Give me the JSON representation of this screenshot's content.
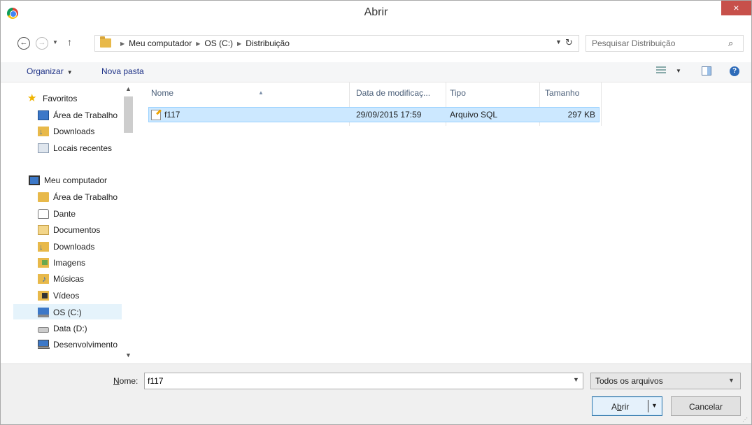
{
  "window": {
    "title": "Abrir",
    "close_label": "×"
  },
  "address": {
    "breadcrumbs": [
      "Meu computador",
      "OS (C:)",
      "Distribuição"
    ],
    "search_placeholder": "Pesquisar Distribuição"
  },
  "toolbar": {
    "organize_label": "Organizar",
    "new_folder_label": "Nova pasta"
  },
  "sidebar": {
    "items": [
      {
        "label": "Favoritos",
        "icon": "star-icon"
      },
      {
        "label": "Área de Trabalho",
        "icon": "desktop-icon"
      },
      {
        "label": "Downloads",
        "icon": "downloads-folder-icon"
      },
      {
        "label": "Locais recentes",
        "icon": "recent-places-icon"
      },
      {
        "label": "Meu computador",
        "icon": "computer-icon"
      },
      {
        "label": "Área de Trabalho",
        "icon": "desktop-folder-icon"
      },
      {
        "label": "Dante",
        "icon": "user-folder-icon"
      },
      {
        "label": "Documentos",
        "icon": "documents-folder-icon"
      },
      {
        "label": "Downloads",
        "icon": "downloads-folder-icon"
      },
      {
        "label": "Imagens",
        "icon": "pictures-folder-icon"
      },
      {
        "label": "Músicas",
        "icon": "music-folder-icon"
      },
      {
        "label": "Vídeos",
        "icon": "videos-folder-icon"
      },
      {
        "label": "OS (C:)",
        "icon": "os-drive-icon",
        "selected": true
      },
      {
        "label": "Data (D:)",
        "icon": "drive-icon"
      },
      {
        "label": "Desenvolvimento",
        "icon": "network-drive-icon"
      }
    ]
  },
  "filelist": {
    "columns": [
      "Nome",
      "Data de modificaç...",
      "Tipo",
      "Tamanho"
    ],
    "rows": [
      {
        "name": "f117",
        "modified": "29/09/2015 17:59",
        "type": "Arquivo SQL",
        "size": "297 KB",
        "selected": true
      }
    ]
  },
  "footer": {
    "name_label_prefix": "N",
    "name_label_rest": "ome:",
    "name_value": "f117",
    "filetype_selected": "Todos os arquivos",
    "open_label_prefix": "A",
    "open_label_u": "b",
    "open_label_rest": "rir",
    "cancel_label": "Cancelar"
  },
  "colors": {
    "selection_bg": "#cce8ff",
    "selection_border": "#99d1ff",
    "close_button": "#c7504a",
    "link_text": "#1e3287"
  }
}
